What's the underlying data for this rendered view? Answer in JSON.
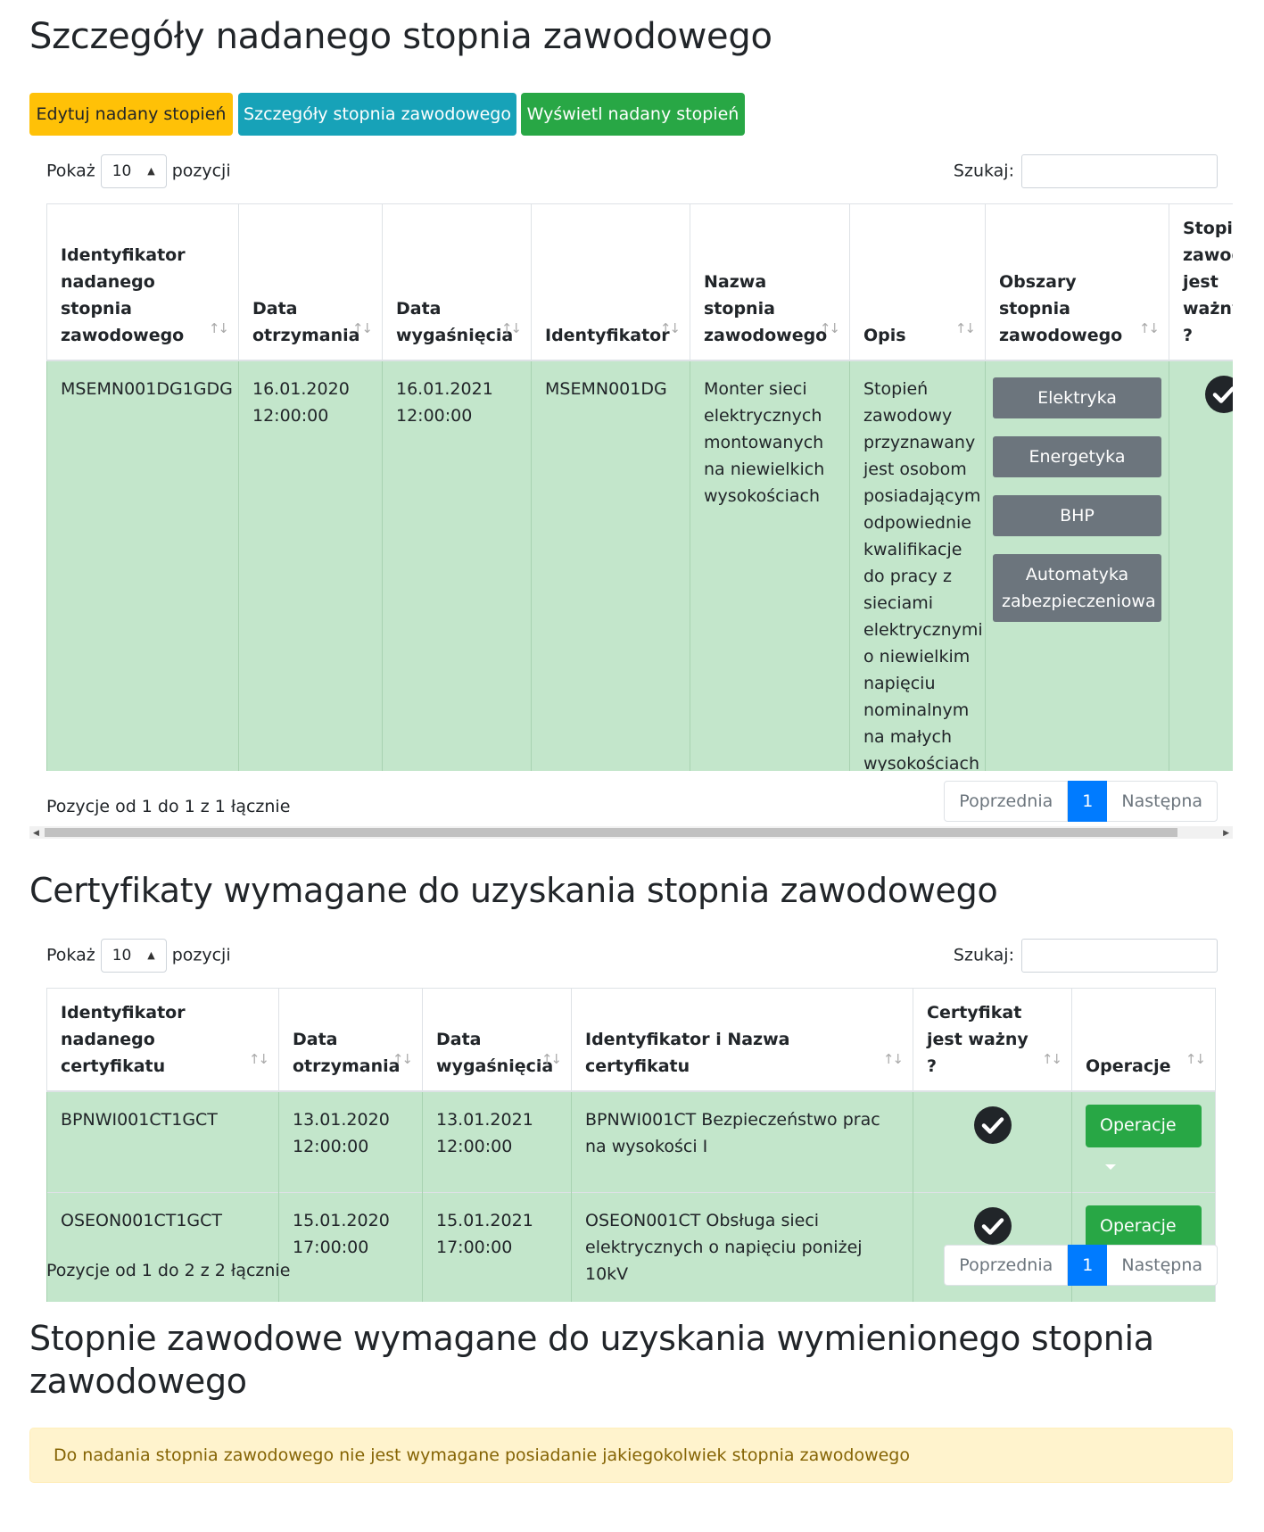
{
  "header": {
    "title": "Szczegóły nadanego stopnia zawodowego"
  },
  "actions": {
    "edit_label": "Edytuj nadany stopień",
    "details_label": "Szczegóły stopnia zawodowego",
    "view_label": "Wyświetl nadany stopień"
  },
  "colors": {
    "warning": "#ffc107",
    "info": "#17a2b8",
    "success": "#28a745",
    "row_success": "#c3e6cb",
    "badge": "#6c757d",
    "primary": "#007bff",
    "alert_bg": "#fff3cd",
    "alert_text": "#856404"
  },
  "table1": {
    "length": {
      "prefix": "Pokaż",
      "value": "10",
      "suffix": "pozycji"
    },
    "search_label": "Szukaj:",
    "columns": [
      "Identyfikator nadanego stopnia zawodowego",
      "Data otrzymania",
      "Data wygaśnięcia",
      "Identyfikator",
      "Nazwa stopnia zawodowego",
      "Opis",
      "Obszary stopnia zawodowego",
      "Stopień zawodowy jest ważny ?"
    ],
    "row": {
      "id": "MSEMN001DG1GDG",
      "received": "16.01.2020 12:00:00",
      "expires": "16.01.2021 12:00:00",
      "identifier": "MSEMN001DG",
      "name": "Monter sieci elektrycznych montowanych na niewielkich wysokościach",
      "description": "Stopień zawodowy przyznawany jest osobom posiadającym odpowiednie kwalifikacje do pracy z sieciami elektrycznymi o niewielkim napięciu nominalnym na małych wysokościach",
      "areas": [
        "Elektryka",
        "Energetyka",
        "BHP",
        "Automatyka zabezpieczeniowa"
      ],
      "valid_icon": "check-circle-icon"
    },
    "info": "Pozycje od 1 do 1 z 1 łącznie",
    "pager": {
      "prev": "Poprzednia",
      "page": "1",
      "next": "Następna"
    }
  },
  "section2": {
    "title": "Certyfikaty wymagane do uzyskania stopnia zawodowego"
  },
  "table2": {
    "length": {
      "prefix": "Pokaż",
      "value": "10",
      "suffix": "pozycji"
    },
    "search_label": "Szukaj:",
    "columns": [
      "Identyfikator nadanego certyfikatu",
      "Data otrzymania",
      "Data wygaśnięcia",
      "Identyfikator i Nazwa certyfikatu",
      "Certyfikat jest ważny ?",
      "Operacje"
    ],
    "rows": [
      {
        "id": "BPNWI001CT1GCT",
        "received": "13.01.2020 12:00:00",
        "expires": "13.01.2021 12:00:00",
        "name": "BPNWI001CT Bezpieczeństwo prac na wysokości I",
        "valid_icon": "check-circle-icon",
        "ops": "Operacje"
      },
      {
        "id": "OSEON001CT1GCT",
        "received": "15.01.2020 17:00:00",
        "expires": "15.01.2021 17:00:00",
        "name": "OSEON001CT Obsługa sieci elektrycznych o napięciu poniżej 10kV",
        "valid_icon": "check-circle-icon",
        "ops": "Operacje"
      }
    ],
    "info": "Pozycje od 1 do 2 z 2 łącznie",
    "pager": {
      "prev": "Poprzednia",
      "page": "1",
      "next": "Następna"
    }
  },
  "section3": {
    "title": "Stopnie zawodowe wymagane do uzyskania wymienionego stopnia zawodowego",
    "alert": "Do nadania stopnia zawodowego nie jest wymagane posiadanie jakiegokolwiek stopnia zawodowego"
  }
}
